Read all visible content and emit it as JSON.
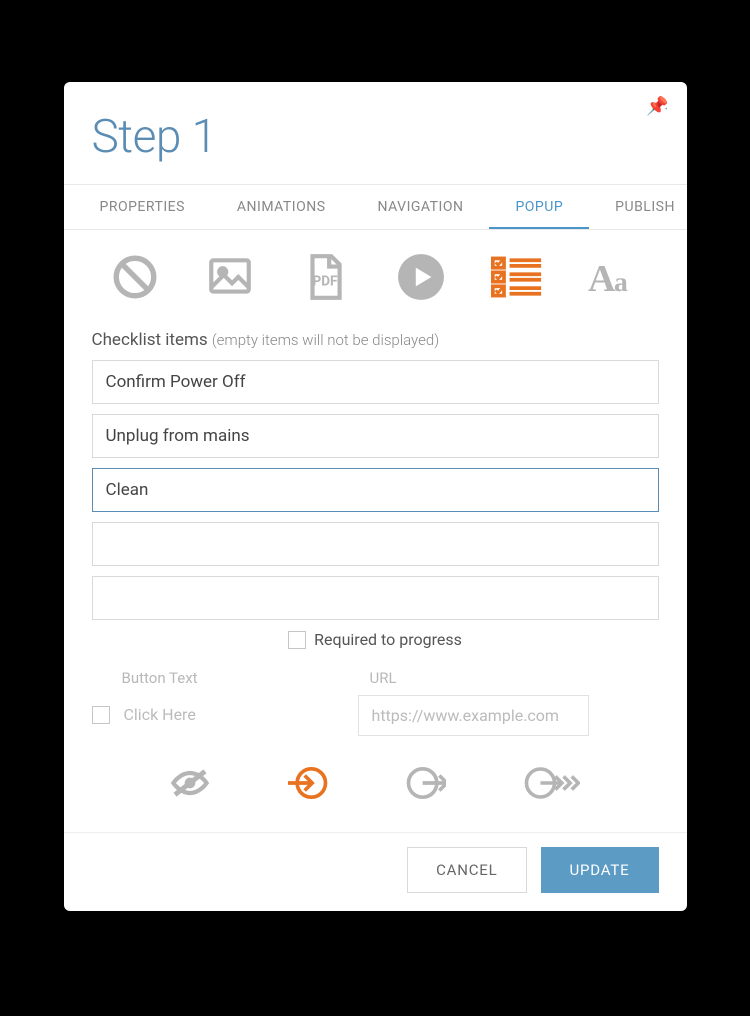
{
  "header": {
    "title": "Step 1"
  },
  "tabs": {
    "items": [
      {
        "label": "PROPERTIES"
      },
      {
        "label": "ANIMATIONS"
      },
      {
        "label": "NAVIGATION"
      },
      {
        "label": "POPUP"
      },
      {
        "label": "PUBLISH"
      }
    ]
  },
  "checklist": {
    "label": "Checklist items",
    "hint": "(empty items will not be displayed)",
    "items": [
      {
        "value": "Confirm Power Off"
      },
      {
        "value": "Unplug from mains"
      },
      {
        "value": "Clean"
      },
      {
        "value": ""
      },
      {
        "value": ""
      }
    ]
  },
  "required": {
    "label": "Required to progress"
  },
  "buttonText": {
    "label": "Button Text",
    "placeholder": "Click Here"
  },
  "url": {
    "label": "URL",
    "placeholder": "https://www.example.com"
  },
  "footer": {
    "cancel": "CANCEL",
    "update": "UPDATE"
  }
}
